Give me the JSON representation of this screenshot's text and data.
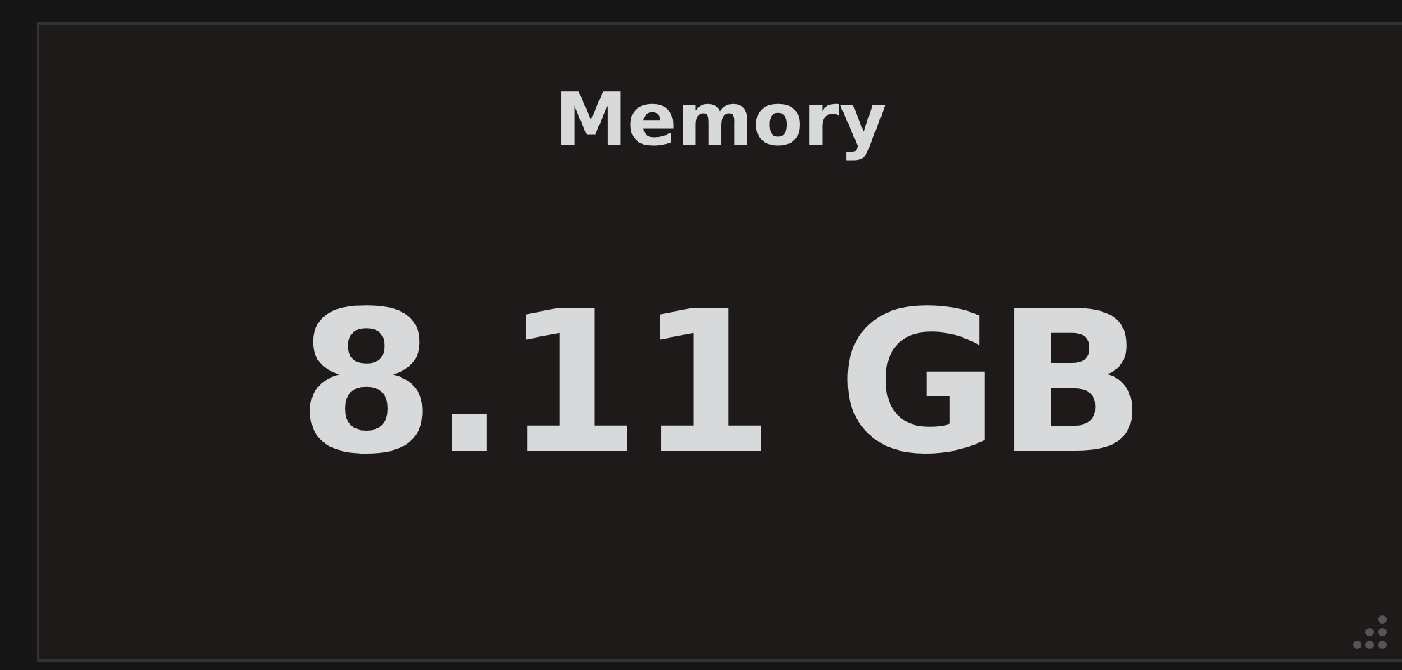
{
  "panel": {
    "title": "Memory",
    "value": "8.11 GB"
  }
}
